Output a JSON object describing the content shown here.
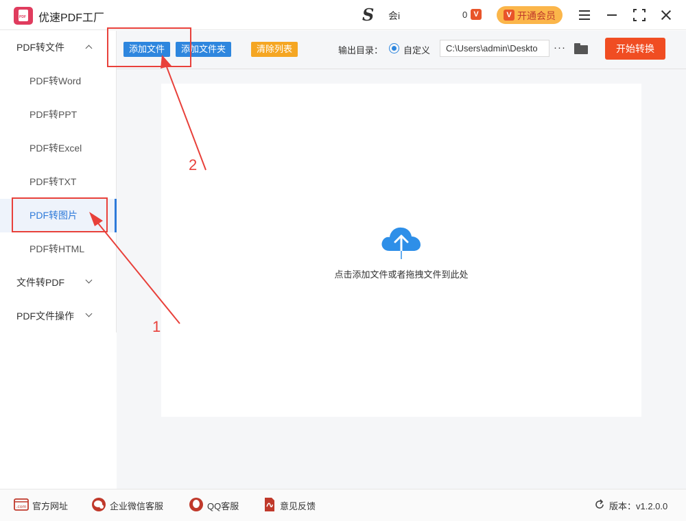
{
  "app": {
    "logo_text": "PDF",
    "title": "优速PDF工厂",
    "user_logo": "S",
    "user_name": "会i",
    "coins": "0",
    "vip_label": "开通会员"
  },
  "sidebar": {
    "items": [
      {
        "label": "PDF转文件",
        "kind": "group",
        "expanded": true
      },
      {
        "label": "PDF转Word",
        "kind": "sub"
      },
      {
        "label": "PDF转PPT",
        "kind": "sub"
      },
      {
        "label": "PDF转Excel",
        "kind": "sub"
      },
      {
        "label": "PDF转TXT",
        "kind": "sub"
      },
      {
        "label": "PDF转图片",
        "kind": "sub",
        "active": true
      },
      {
        "label": "PDF转HTML",
        "kind": "sub"
      },
      {
        "label": "文件转PDF",
        "kind": "group",
        "expanded": false
      },
      {
        "label": "PDF文件操作",
        "kind": "group",
        "expanded": false
      }
    ]
  },
  "toolbar": {
    "add_file": "添加文件",
    "add_folder": "添加文件夹",
    "clear_list": "清除列表",
    "output_label": "输出目录：",
    "radio_label": "自定义",
    "output_path": "C:\\Users\\admin\\Deskto",
    "more": "···",
    "start": "开始转换"
  },
  "dropzone": {
    "text": "点击添加文件或者拖拽文件到此处"
  },
  "footer": {
    "website": "官方网址",
    "wechat": "企业微信客服",
    "qq": "QQ客服",
    "feedback": "意见反馈",
    "version": "版本：v1.2.0.0"
  },
  "annotations": {
    "step1": "1",
    "step2": "2"
  },
  "colors": {
    "accent": "#2e86de",
    "start_button": "#f04d22",
    "annotation": "#e8403a"
  }
}
